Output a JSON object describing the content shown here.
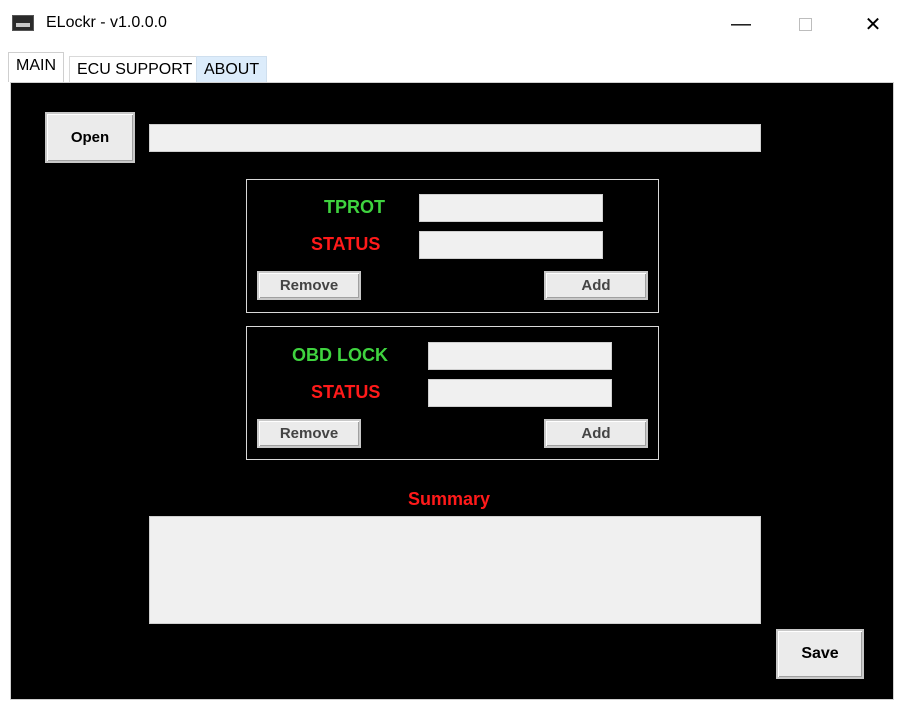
{
  "window": {
    "title": "ELockr - v1.0.0.0",
    "minimize_glyph": "—",
    "close_glyph": "✕"
  },
  "tabs": [
    {
      "label": "MAIN",
      "active": true
    },
    {
      "label": "ECU SUPPORT",
      "active": false
    },
    {
      "label": "ABOUT",
      "active": false
    }
  ],
  "main": {
    "open_label": "Open",
    "file_path": "",
    "tprot": {
      "title": "TPROT",
      "status_label": "STATUS",
      "value": "",
      "status": "",
      "remove_label": "Remove",
      "add_label": "Add"
    },
    "obd": {
      "title": "OBD LOCK",
      "status_label": "STATUS",
      "value": "",
      "status": "",
      "remove_label": "Remove",
      "add_label": "Add"
    },
    "summary_label": "Summary",
    "summary_text": "",
    "save_label": "Save"
  },
  "colors": {
    "panel_bg": "#000000",
    "label_green": "#3fd33f",
    "label_red": "#ff1a1a",
    "field_bg": "#f0f0f0"
  }
}
